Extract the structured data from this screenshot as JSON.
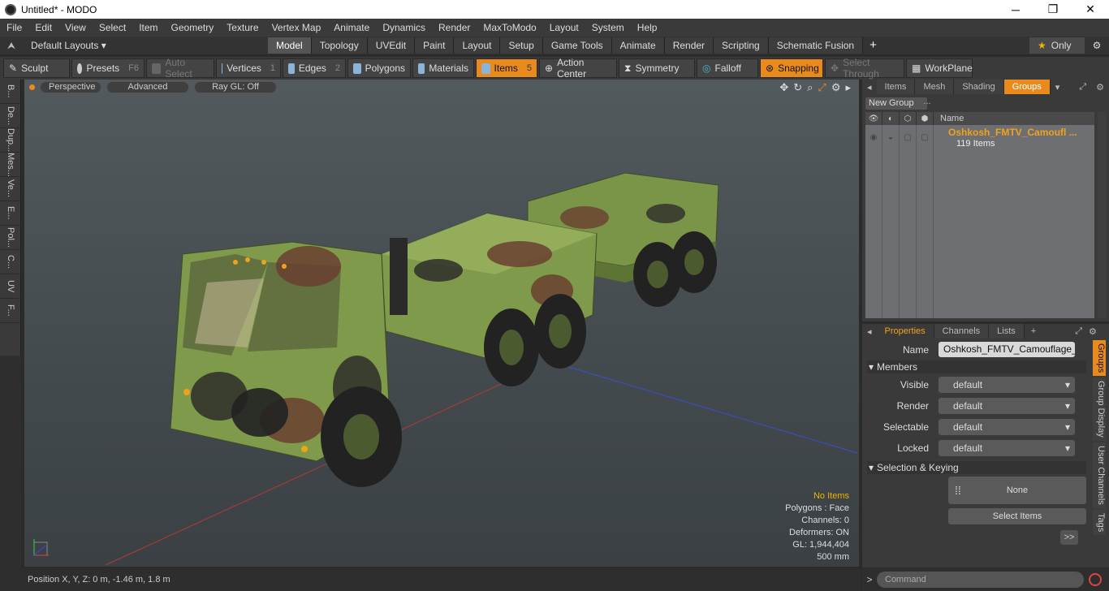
{
  "window": {
    "title": "Untitled* - MODO",
    "min": "─",
    "max": "❐",
    "close": "✕"
  },
  "menu": [
    "File",
    "Edit",
    "View",
    "Select",
    "Item",
    "Geometry",
    "Texture",
    "Vertex Map",
    "Animate",
    "Dynamics",
    "Render",
    "MaxToModo",
    "Layout",
    "System",
    "Help"
  ],
  "layouts": {
    "label": "Default Layouts ▾",
    "tabs": [
      "Model",
      "Topology",
      "UVEdit",
      "Paint",
      "Layout",
      "Setup",
      "Game Tools",
      "Animate",
      "Render",
      "Scripting",
      "Schematic Fusion"
    ],
    "active": "Model",
    "only": "Only"
  },
  "toolbar": {
    "sculpt": "Sculpt",
    "presets": "Presets",
    "presets_key": "F6",
    "auto_select": "Auto Select",
    "vertices": "Vertices",
    "vertices_key": "1",
    "edges": "Edges",
    "edges_key": "2",
    "polygons": "Polygons",
    "materials": "Materials",
    "items": "Items",
    "items_key": "5",
    "action_center": "Action Center",
    "symmetry": "Symmetry",
    "falloff": "Falloff",
    "snapping": "Snapping",
    "select_through": "Select Through",
    "workplane": "WorkPlane"
  },
  "left_strip": [
    "B...",
    "De...",
    "Dup...",
    "Mes...",
    "Ve...",
    "E...",
    "Pol...",
    "C...",
    "UV",
    "F..."
  ],
  "viewport": {
    "perspective": "Perspective",
    "advanced": "Advanced",
    "raygl": "Ray GL: Off",
    "stats": {
      "no_items": "No Items",
      "polygons": "Polygons : Face",
      "channels": "Channels: 0",
      "deformers": "Deformers: ON",
      "gl": "GL: 1,944,404",
      "size": "500 mm"
    }
  },
  "status": {
    "position": "Position X, Y, Z:   0 m, -1.46 m, 1.8 m"
  },
  "command": {
    "placeholder": "Command"
  },
  "groups_panel": {
    "tabs": [
      "Items",
      "Mesh ...",
      "Shading",
      "Groups"
    ],
    "active": "Groups",
    "new_group": "New Group",
    "name_header": "Name",
    "row_title": "Oshkosh_FMTV_Camoufl ...",
    "row_sub": "119 Items"
  },
  "properties": {
    "tabs": [
      "Properties",
      "Channels",
      "Lists"
    ],
    "name_label": "Name",
    "name_value": "Oshkosh_FMTV_Camouflage_Car",
    "members": "Members",
    "visible_label": "Visible",
    "render_label": "Render",
    "selectable_label": "Selectable",
    "locked_label": "Locked",
    "default": "default",
    "selection_keying": "Selection & Keying",
    "none": "None",
    "select_items": "Select Items",
    "more": ">>",
    "vtabs": [
      "Groups",
      "Group Display",
      "User Channels",
      "Tags"
    ]
  }
}
